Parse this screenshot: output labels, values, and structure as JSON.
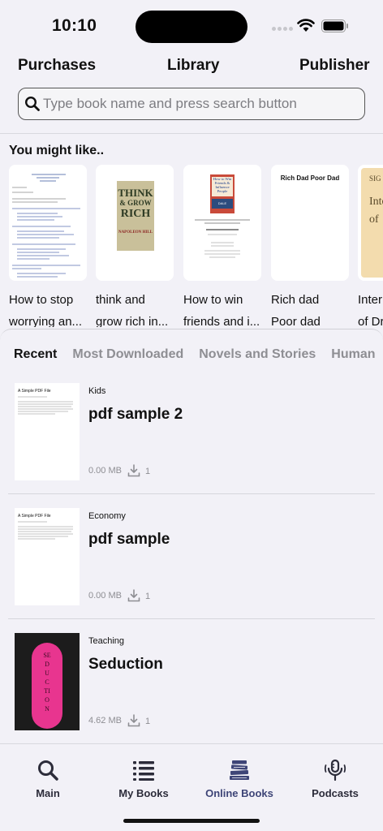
{
  "status_bar": {
    "time": "10:10"
  },
  "top_tabs": [
    "Purchases",
    "Library",
    "Publisher"
  ],
  "search": {
    "placeholder": "Type book name and press search button",
    "value": ""
  },
  "recommendations": {
    "title": "You might like..",
    "items": [
      {
        "title_line1": "How to stop",
        "title_line2": "worrying an...",
        "cover": "text-document"
      },
      {
        "title_line1": "think and",
        "title_line2": "grow rich in...",
        "cover": "think-and-grow-rich",
        "cover_text": [
          "THINK",
          "& GROW",
          "RICH"
        ],
        "cover_author": "NAPOLEON HILL"
      },
      {
        "title_line1": "How to win",
        "title_line2": "friends and i...",
        "cover": "how-to-win-friends",
        "cover_text": [
          "How to Win",
          "Friends &",
          "Influence",
          "People"
        ],
        "cover_author": "DALE CARNEGIE"
      },
      {
        "title_line1": "Rich dad",
        "title_line2": "Poor dad",
        "cover": "rich-dad-poor-dad",
        "cover_text": [
          "Rich Dad Poor Dad"
        ]
      },
      {
        "title_line1": "Inter",
        "title_line2": "of Dr",
        "cover": "interpretation-of-dreams",
        "cover_text": [
          "SIG",
          "Inte",
          "of"
        ]
      }
    ]
  },
  "categories": {
    "tabs": [
      "Recent",
      "Most Downloaded",
      "Novels and Stories",
      "Human"
    ],
    "active": "Recent"
  },
  "books": [
    {
      "category": "Kids",
      "title": "pdf sample 2",
      "size": "0.00 MB",
      "downloads": "1",
      "cover": "pdf",
      "cover_heading": "A Simple PDF File"
    },
    {
      "category": "Economy",
      "title": "pdf sample",
      "size": "0.00 MB",
      "downloads": "1",
      "cover": "pdf",
      "cover_heading": "A Simple PDF File"
    },
    {
      "category": "Teaching",
      "title": "Seduction",
      "size": "4.62 MB",
      "downloads": "1",
      "cover": "seduction",
      "cover_text": "SEDUCTION"
    }
  ],
  "bottom_nav": {
    "items": [
      {
        "label": "Main",
        "icon": "search-icon"
      },
      {
        "label": "My Books",
        "icon": "list-icon"
      },
      {
        "label": "Online Books",
        "icon": "books-stack-icon"
      },
      {
        "label": "Podcasts",
        "icon": "microphone-icon"
      }
    ],
    "active": "Online Books"
  },
  "colors": {
    "background": "#f2f1f7",
    "active_nav": "#3e4577",
    "muted": "#8e8e93",
    "seduction_pink": "#e8358f"
  }
}
